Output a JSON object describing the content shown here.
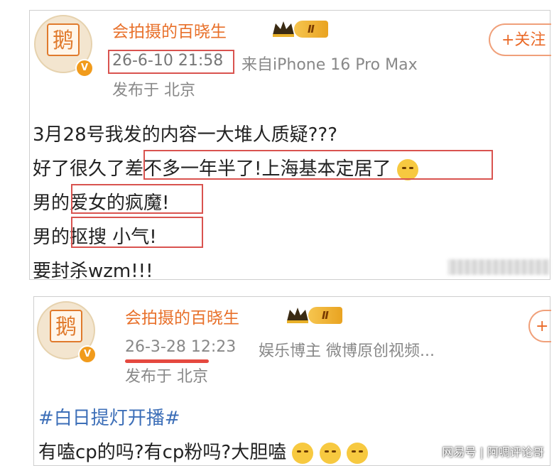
{
  "post1": {
    "username": "会拍摄的百晓生",
    "level_badge": "Ⅱ",
    "time": "26-6-10 21:58",
    "source": "来自iPhone 16 Pro Max",
    "location": "发布于 北京",
    "follow_label": "+关注",
    "lines": [
      "3月28号我发的内容一大堆人质疑???",
      "好了很久了差不多一年半了!上海基本定居了",
      "男的爱女的疯魔!",
      "男的抠搜 小气!",
      "要封杀wzm!!!"
    ],
    "line_parts": {
      "l2a": "好了很久了",
      "l2b": "差不多一年半了!上海基本定居了",
      "l3a": "男的",
      "l3b": "爱女的疯魔!",
      "l4a": "男的",
      "l4b": "抠搜 小气!"
    }
  },
  "post2": {
    "username": "会拍摄的百晓生",
    "level_badge": "Ⅱ",
    "time": "26-3-28 12:23",
    "source": "娱乐博主 微博原创视频...",
    "location": "发布于 北京",
    "follow_label": "+",
    "hashtag": "#白日提灯开播#",
    "text": "有嗑cp的吗?有cp粉吗?大胆嗑"
  },
  "avatar_text": "鹅",
  "watermark": "网易号 | 阿啁评论哥",
  "colors": {
    "accent": "#e8702a",
    "highlight_box": "#d9534f",
    "hashtag": "#3d6fb8"
  }
}
